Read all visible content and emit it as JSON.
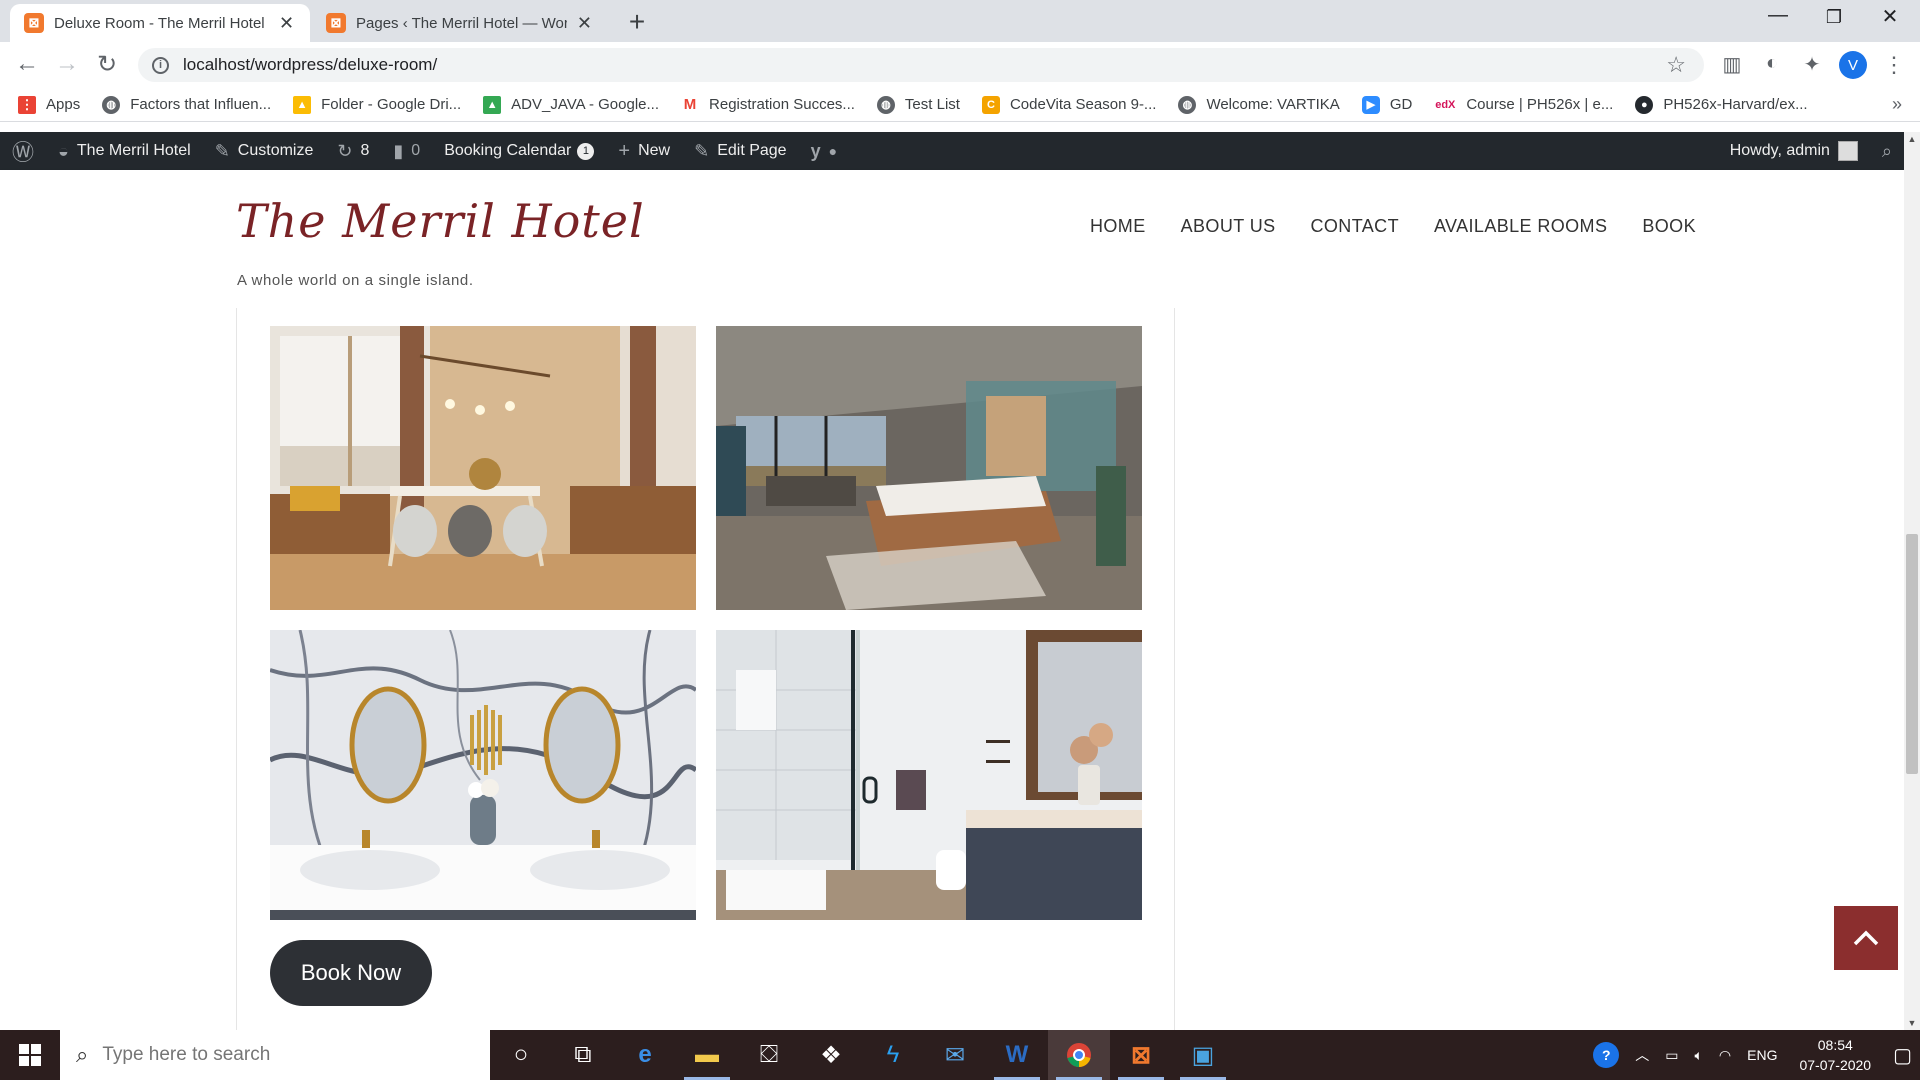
{
  "browser": {
    "tabs": [
      {
        "title": "Deluxe Room - The Merril Hotel",
        "active": true
      },
      {
        "title": "Pages ‹ The Merril Hotel — WordPress",
        "active": false
      }
    ],
    "address": "localhost/wordpress/deluxe-room/",
    "profile_initial": "V",
    "bookmarks": [
      {
        "label": "Apps",
        "icon": "apps-grid-icon",
        "color": "#ea4335"
      },
      {
        "label": "Factors that Influen...",
        "icon": "globe-icon",
        "color": "#5f6368"
      },
      {
        "label": "Folder - Google Dri...",
        "icon": "google-drive-icon",
        "color": "#fbbc04"
      },
      {
        "label": "ADV_JAVA - Google...",
        "icon": "google-drive-icon",
        "color": "#34a853"
      },
      {
        "label": "Registration Succes...",
        "icon": "gmail-icon",
        "color": "#ea4335"
      },
      {
        "label": "Test List",
        "icon": "globe-icon",
        "color": "#5f6368"
      },
      {
        "label": "CodeVita Season 9-...",
        "icon": "codevita-icon",
        "color": "#f4a300"
      },
      {
        "label": "Welcome: VARTIKA",
        "icon": "globe-icon",
        "color": "#5f6368"
      },
      {
        "label": "GD",
        "icon": "zoom-icon",
        "color": "#2d8cff"
      },
      {
        "label": "Course | PH526x | e...",
        "icon": "edx-icon",
        "color": "#d4145a"
      },
      {
        "label": "PH526x-Harvard/ex...",
        "icon": "github-icon",
        "color": "#24292e"
      }
    ]
  },
  "adminbar": {
    "site": "The Merril Hotel",
    "customize": "Customize",
    "updates": "8",
    "comments": "0",
    "booking": "Booking Calendar",
    "booking_count": "1",
    "new": "New",
    "edit": "Edit Page",
    "howdy": "Howdy, admin"
  },
  "site": {
    "title": "The Merril Hotel",
    "tagline": "A whole world on a single island.",
    "nav": [
      "HOME",
      "ABOUT US",
      "CONTACT",
      "AVAILABLE ROOMS",
      "BOOK"
    ]
  },
  "content": {
    "photos": [
      "dining-room-photo",
      "bedroom-photo",
      "marble-bathroom-photo",
      "shower-bathroom-photo"
    ],
    "book_button": "Book Now"
  },
  "taskbar": {
    "search_placeholder": "Type here to search",
    "lang": "ENG",
    "time": "08:54",
    "date": "07-07-2020"
  },
  "colors": {
    "brand": "#7a2326",
    "admin_bar": "#23282d",
    "back_to_top": "#8b2e2e",
    "button": "#2d3035"
  }
}
